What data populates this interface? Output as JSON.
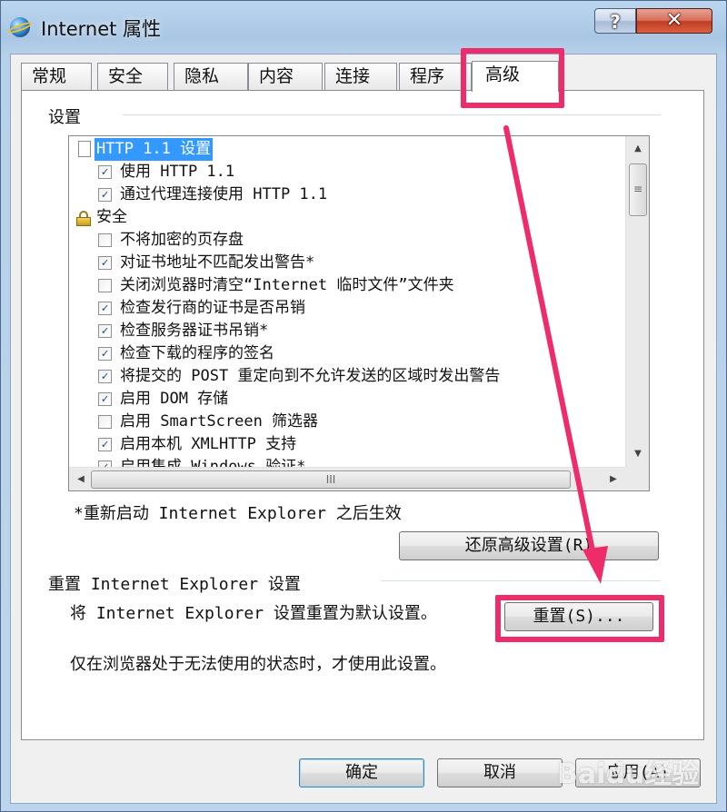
{
  "window": {
    "title": "Internet 属性",
    "help_glyph": "?",
    "close_glyph": "✕"
  },
  "tabs": [
    {
      "label": "常规"
    },
    {
      "label": "安全"
    },
    {
      "label": "隐私"
    },
    {
      "label": "内容"
    },
    {
      "label": "连接"
    },
    {
      "label": "程序"
    },
    {
      "label": "高级",
      "active": true
    }
  ],
  "settings": {
    "group_label": "设置",
    "items": [
      {
        "kind": "category",
        "icon": "page-icon",
        "text": "HTTP 1.1 设置",
        "selected": true
      },
      {
        "kind": "option",
        "checked": true,
        "text": "使用 HTTP 1.1"
      },
      {
        "kind": "option",
        "checked": true,
        "text": "通过代理连接使用 HTTP 1.1"
      },
      {
        "kind": "category",
        "icon": "lock-icon",
        "text": "安全"
      },
      {
        "kind": "option",
        "checked": false,
        "text": "不将加密的页存盘"
      },
      {
        "kind": "option",
        "checked": true,
        "text": "对证书地址不匹配发出警告*"
      },
      {
        "kind": "option",
        "checked": false,
        "text": "关闭浏览器时清空“Internet 临时文件”文件夹"
      },
      {
        "kind": "option",
        "checked": true,
        "text": "检查发行商的证书是否吊销"
      },
      {
        "kind": "option",
        "checked": true,
        "text": "检查服务器证书吊销*"
      },
      {
        "kind": "option",
        "checked": true,
        "text": "检查下载的程序的签名"
      },
      {
        "kind": "option",
        "checked": true,
        "text": "将提交的 POST 重定向到不允许发送的区域时发出警告"
      },
      {
        "kind": "option",
        "checked": true,
        "text": "启用 DOM 存储"
      },
      {
        "kind": "option",
        "checked": false,
        "text": "启用 SmartScreen 筛选器"
      },
      {
        "kind": "option",
        "checked": true,
        "text": "启用本机 XMLHTTP 支持"
      },
      {
        "kind": "option",
        "checked": true,
        "text": "启用集成 Windows 验证*"
      }
    ],
    "restart_note": "*重新启动 Internet Explorer 之后生效",
    "restore_button": "还原高级设置(R)"
  },
  "reset": {
    "section_title": "重置 Internet Explorer 设置",
    "description": "将 Internet Explorer 设置重置为默认设置。",
    "button": "重置(S)...",
    "warning": "仅在浏览器处于无法使用的状态时，才使用此设置。"
  },
  "footer": {
    "ok": "确定",
    "cancel": "取消",
    "apply": "应用(A)"
  },
  "watermark": "Baidu经验",
  "colors": {
    "highlight": "#ee2c6a",
    "selection": "#3399ff"
  }
}
